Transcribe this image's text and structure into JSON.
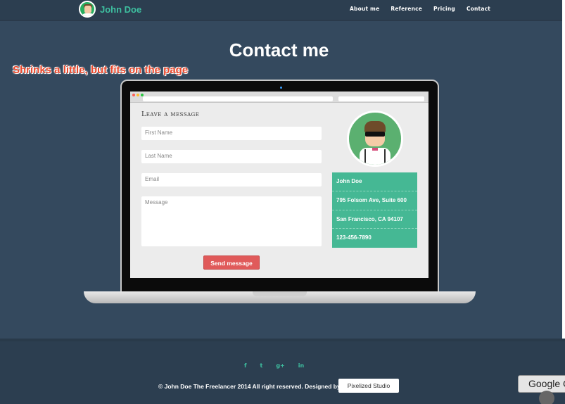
{
  "nav": {
    "brand": "John Doe",
    "links": [
      "About me",
      "Reference",
      "Pricing",
      "Contact"
    ]
  },
  "page": {
    "title": "Contact me",
    "annotation": "Shrinks a little, but fits on the page"
  },
  "contact_form": {
    "heading": "Leave a message",
    "first_name_placeholder": "First Name",
    "last_name_placeholder": "Last Name",
    "email_placeholder": "Email",
    "message_placeholder": "Message",
    "send_label": "Send message"
  },
  "info_card": {
    "name": "John Doe",
    "address": "795 Folsom Ave, Suite 600",
    "city": "San Francisco, CA 94107",
    "phone": "123-456-7890"
  },
  "footer": {
    "social": [
      "f",
      "t",
      "g+",
      "in"
    ],
    "copyright": "© John Doe The Freelancer 2014 All right reserved. Designed by",
    "studio_label": "Pixelized Studio"
  },
  "overlay": {
    "google_tip": "Google C"
  },
  "colors": {
    "background": "#34495e",
    "accent": "#45b894",
    "send_button": "#e05a5a"
  }
}
